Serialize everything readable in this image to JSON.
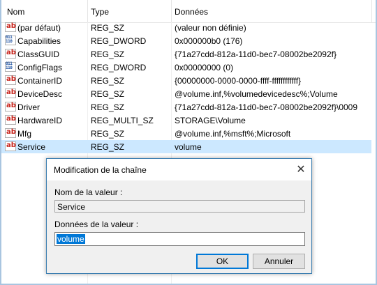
{
  "columns": {
    "name": "Nom",
    "type": "Type",
    "data": "Données"
  },
  "rows": [
    {
      "name": "(par défaut)",
      "type": "REG_SZ",
      "data": "(valeur non définie)",
      "icon": "string-value-icon"
    },
    {
      "name": "Capabilities",
      "type": "REG_DWORD",
      "data": "0x000000b0 (176)",
      "icon": "binary-value-icon"
    },
    {
      "name": "ClassGUID",
      "type": "REG_SZ",
      "data": "{71a27cdd-812a-11d0-bec7-08002be2092f}",
      "icon": "string-value-icon"
    },
    {
      "name": "ConfigFlags",
      "type": "REG_DWORD",
      "data": "0x00000000 (0)",
      "icon": "binary-value-icon"
    },
    {
      "name": "ContainerID",
      "type": "REG_SZ",
      "data": "{00000000-0000-0000-ffff-ffffffffffff}",
      "icon": "string-value-icon"
    },
    {
      "name": "DeviceDesc",
      "type": "REG_SZ",
      "data": "@volume.inf,%volumedevicedesc%;Volume",
      "icon": "string-value-icon"
    },
    {
      "name": "Driver",
      "type": "REG_SZ",
      "data": "{71a27cdd-812a-11d0-bec7-08002be2092f}\\0009",
      "icon": "string-value-icon"
    },
    {
      "name": "HardwareID",
      "type": "REG_MULTI_SZ",
      "data": "STORAGE\\Volume",
      "icon": "string-value-icon"
    },
    {
      "name": "Mfg",
      "type": "REG_SZ",
      "data": "@volume.inf,%msft%;Microsoft",
      "icon": "string-value-icon"
    },
    {
      "name": "Service",
      "type": "REG_SZ",
      "data": "volume",
      "icon": "string-value-icon",
      "selected": true
    }
  ],
  "icon_glyphs": {
    "string": "ab",
    "binary": "011\n110"
  },
  "dialog": {
    "title": "Modification de la chaîne",
    "value_name_label": "Nom de la valeur :",
    "value_name": "Service",
    "value_data_label": "Données de la valeur :",
    "value_data": "volume",
    "ok_label": "OK",
    "cancel_label": "Annuler"
  },
  "colors": {
    "selection": "#cce8ff",
    "accent": "#0078d7",
    "string_icon_text": "#c8221a",
    "binary_icon_text": "#1a4fa0"
  }
}
